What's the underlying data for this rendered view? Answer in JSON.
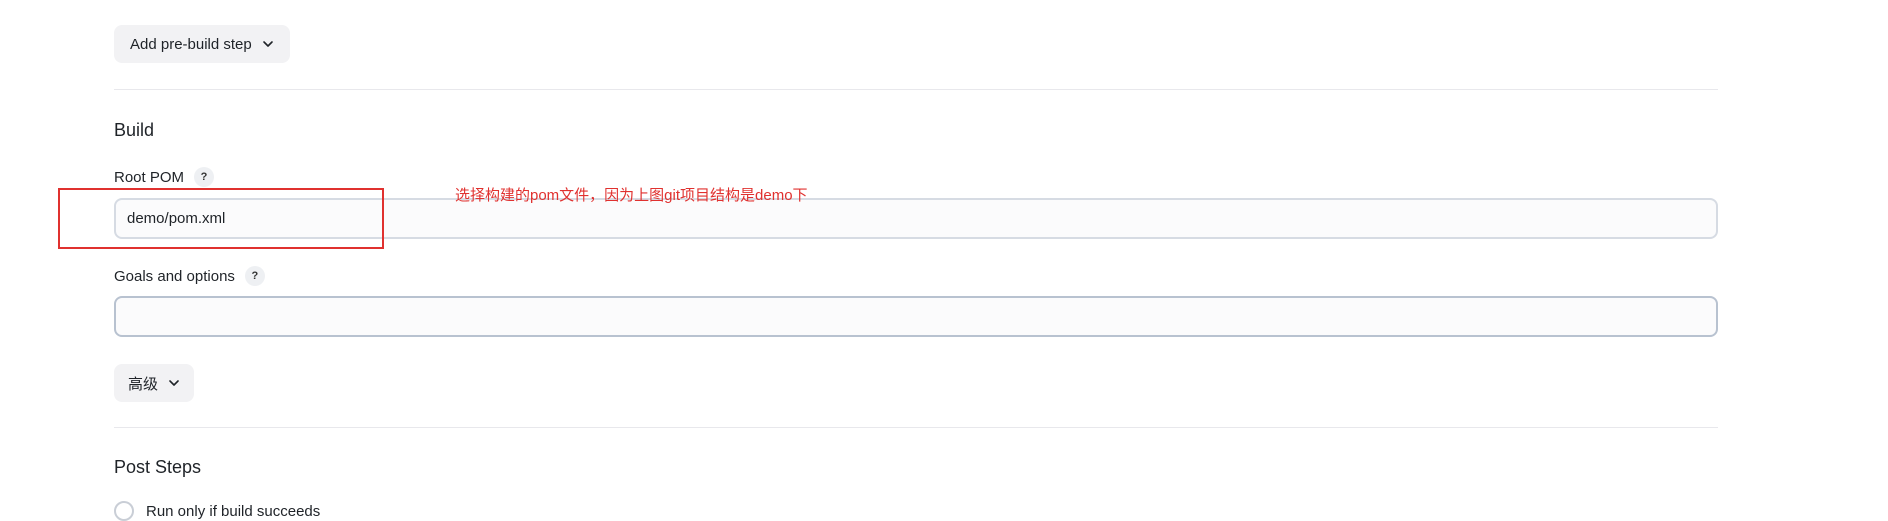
{
  "pre_build": {
    "add_button_label": "Add pre-build step"
  },
  "build": {
    "section_title": "Build",
    "root_pom": {
      "label": "Root POM",
      "help": "?",
      "value": "demo/pom.xml"
    },
    "goals": {
      "label": "Goals and options",
      "help": "?",
      "value": ""
    },
    "advanced_label": "高级"
  },
  "annotation": {
    "text": "选择构建的pom文件，因为上图git项目结构是demo下",
    "color": "#e0312f"
  },
  "post_steps": {
    "section_title": "Post Steps",
    "options": [
      {
        "label": "Run only if build succeeds",
        "selected": false
      }
    ]
  },
  "icons": [
    "chevron-down-icon",
    "help-icon",
    "radio-icon"
  ]
}
